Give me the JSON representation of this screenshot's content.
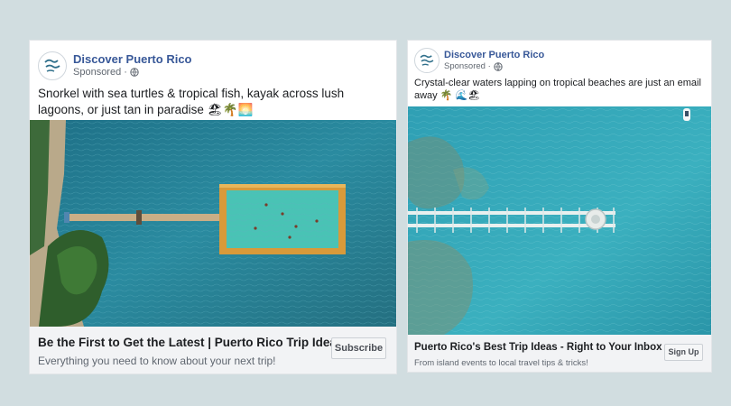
{
  "colors": {
    "background": "#d1dde0",
    "page_name": "#385898",
    "footer": "#f2f3f5",
    "ocean": "#2a8ba0"
  },
  "ads": [
    {
      "page_name": "Discover Puerto Rico",
      "sponsored": "Sponsored ·",
      "caption": "Snorkel with sea turtles & tropical fish, kayak across lush lagoons, or just tan in paradise 🏖🌴🌅",
      "image_icon": "aerial-pier-pool-photo",
      "headline": "Be the First to Get the Latest | Puerto Rico Trip Ideas",
      "description": "Everything you need to know about your next trip!",
      "cta": "Subscribe"
    },
    {
      "page_name": "Discover Puerto Rico",
      "sponsored": "Sponsored ·",
      "caption": "Crystal-clear waters lapping on tropical beaches are just an email away 🌴 🌊🏖",
      "image_icon": "aerial-pier-ocean-photo",
      "headline": "Puerto Rico's Best Trip Ideas - Right to Your Inbox",
      "description": "From island events to local travel tips & tricks!",
      "cta": "Sign Up"
    }
  ]
}
